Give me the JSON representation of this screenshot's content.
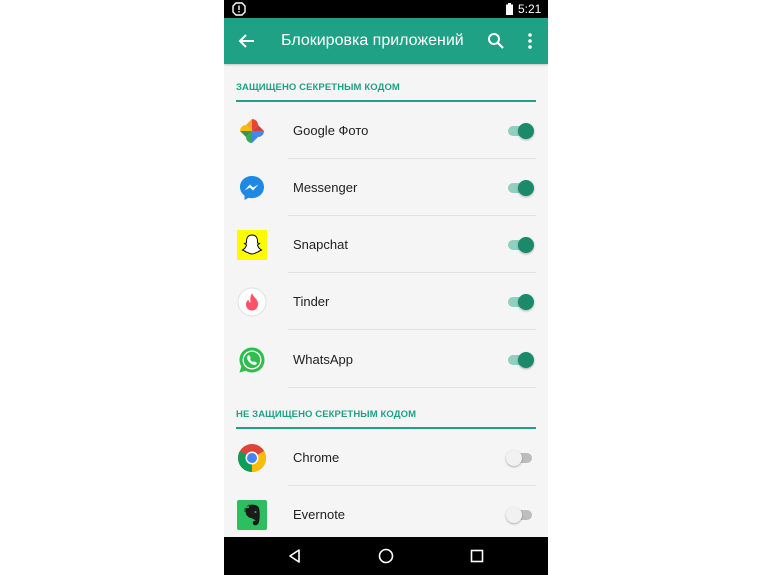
{
  "status_bar": {
    "time": "5:21"
  },
  "app_bar": {
    "title": "Блокировка приложений"
  },
  "sections": {
    "protected": {
      "header": "ЗАЩИЩЕНО СЕКРЕТНЫМ КОДОМ",
      "items": [
        {
          "name": "Google Фото",
          "icon": "google-photos-icon",
          "enabled": true
        },
        {
          "name": "Messenger",
          "icon": "messenger-icon",
          "enabled": true
        },
        {
          "name": "Snapchat",
          "icon": "snapchat-icon",
          "enabled": true
        },
        {
          "name": "Tinder",
          "icon": "tinder-icon",
          "enabled": true
        },
        {
          "name": "WhatsApp",
          "icon": "whatsapp-icon",
          "enabled": true
        }
      ]
    },
    "unprotected": {
      "header": "НЕ ЗАЩИЩЕНО СЕКРЕТНЫМ КОДОМ",
      "items": [
        {
          "name": "Chrome",
          "icon": "chrome-icon",
          "enabled": false
        },
        {
          "name": "Evernote",
          "icon": "evernote-icon",
          "enabled": false
        }
      ]
    }
  },
  "colors": {
    "accent": "#1fa185",
    "toggle_on_thumb": "#1b8a6b",
    "toggle_on_track": "#8fd0c0",
    "background": "#f5f5f5"
  }
}
